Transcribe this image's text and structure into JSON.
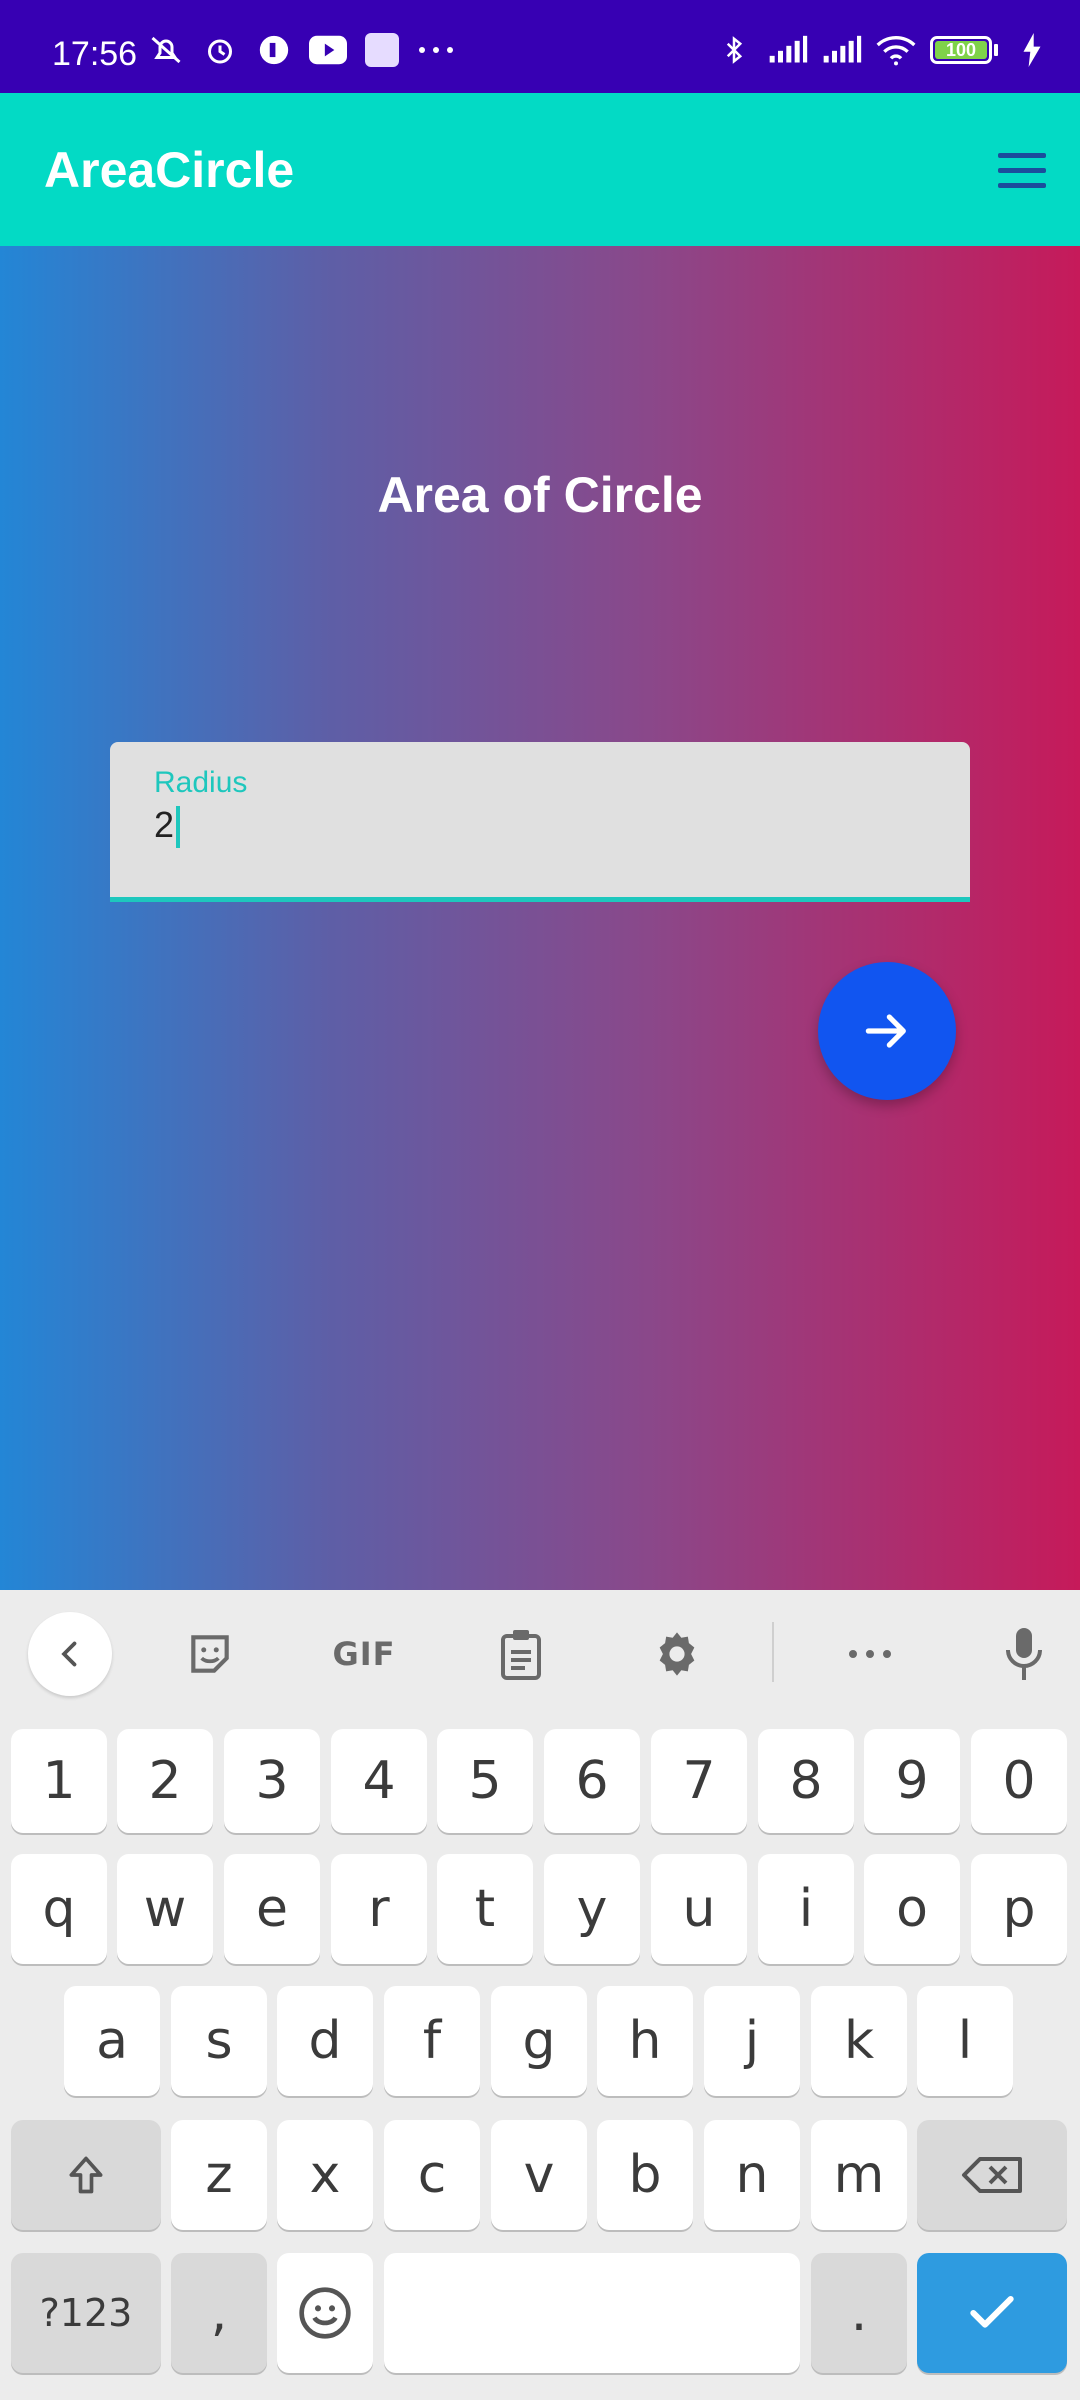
{
  "status_bar": {
    "time": "17:56",
    "left_icons": [
      "muted-bell-icon",
      "alarm-icon",
      "app-icon",
      "youtube-icon",
      "square-icon",
      "more-dots-icon"
    ],
    "right_icons": [
      "bluetooth-icon",
      "signal-icon",
      "signal-icon",
      "wifi-icon",
      "battery-icon",
      "charging-icon"
    ],
    "battery_level": "100"
  },
  "app_bar": {
    "title": "AreaCircle",
    "menu_icon": "hamburger-menu-icon",
    "background_color": "#03dac5"
  },
  "main": {
    "heading": "Area of Circle",
    "input": {
      "label": "Radius",
      "value": "2"
    },
    "submit_icon": "arrow-right-icon",
    "fab_color": "#1155f0",
    "gradient_colors": [
      "#2386d6",
      "#c61a5a"
    ]
  },
  "keyboard": {
    "toolbar": [
      "back-chevron-icon",
      "sticker-icon",
      "gif-icon",
      "clipboard-icon",
      "settings-gear-icon",
      "more-dots-icon",
      "microphone-icon"
    ],
    "gif_label": "GIF",
    "row_numbers": [
      "1",
      "2",
      "3",
      "4",
      "5",
      "6",
      "7",
      "8",
      "9",
      "0"
    ],
    "row_q": [
      "q",
      "w",
      "e",
      "r",
      "t",
      "y",
      "u",
      "i",
      "o",
      "p"
    ],
    "row_a": [
      "a",
      "s",
      "d",
      "f",
      "g",
      "h",
      "j",
      "k",
      "l"
    ],
    "row_z": [
      "z",
      "x",
      "c",
      "v",
      "b",
      "n",
      "m"
    ],
    "symbols_label": "?123",
    "comma_label": ",",
    "period_label": ".",
    "enter_color": "#2e9be0"
  }
}
